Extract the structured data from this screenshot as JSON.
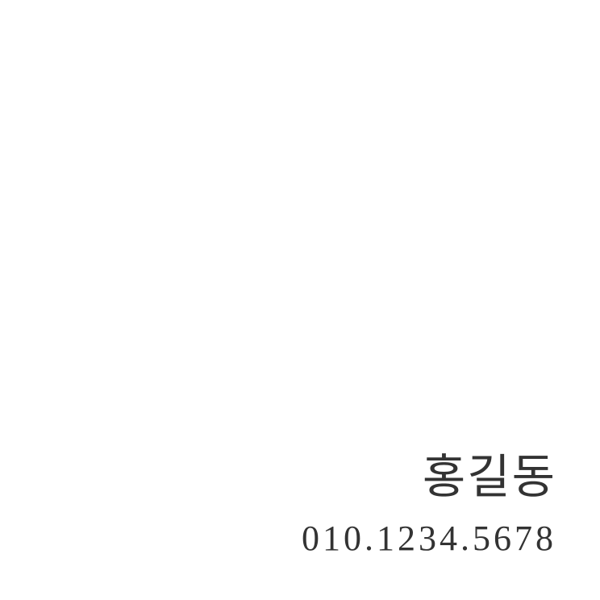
{
  "card": {
    "name": "홍길동",
    "phone": "010.1234.5678",
    "text_color": "#333333",
    "background_color": "#ffffff"
  }
}
